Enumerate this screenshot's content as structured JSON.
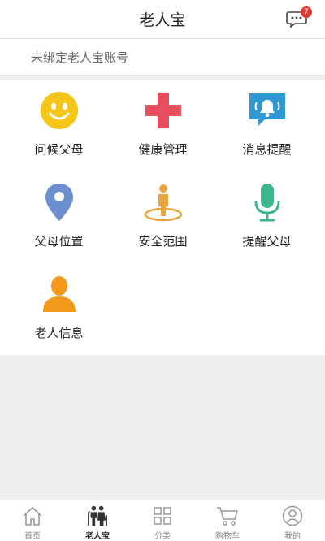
{
  "header": {
    "title": "老人宝",
    "message_badge": "7",
    "message_icon": "chat-bubble-icon"
  },
  "bind_bar": {
    "text": "未绑定老人宝账号"
  },
  "grid": [
    {
      "label": "问候父母",
      "icon": "smiley-icon",
      "color": "#f5c518"
    },
    {
      "label": "健康管理",
      "icon": "medical-cross-icon",
      "color": "#e84f5e"
    },
    {
      "label": "消息提醒",
      "icon": "bell-message-icon",
      "color": "#2f97d2"
    },
    {
      "label": "父母位置",
      "icon": "location-pin-icon",
      "color": "#6c8fd0"
    },
    {
      "label": "安全范围",
      "icon": "person-safe-zone-icon",
      "color": "#e9a640"
    },
    {
      "label": "提醒父母",
      "icon": "microphone-icon",
      "color": "#3fb58d"
    },
    {
      "label": "老人信息",
      "icon": "person-icon",
      "color": "#f39a1b"
    }
  ],
  "tabbar": [
    {
      "label": "首页",
      "icon": "home-icon",
      "active": false
    },
    {
      "label": "老人宝",
      "icon": "elderly-couple-icon",
      "active": true
    },
    {
      "label": "分类",
      "icon": "category-grid-icon",
      "active": false
    },
    {
      "label": "购物车",
      "icon": "shopping-cart-icon",
      "active": false
    },
    {
      "label": "我的",
      "icon": "profile-icon",
      "active": false
    }
  ]
}
